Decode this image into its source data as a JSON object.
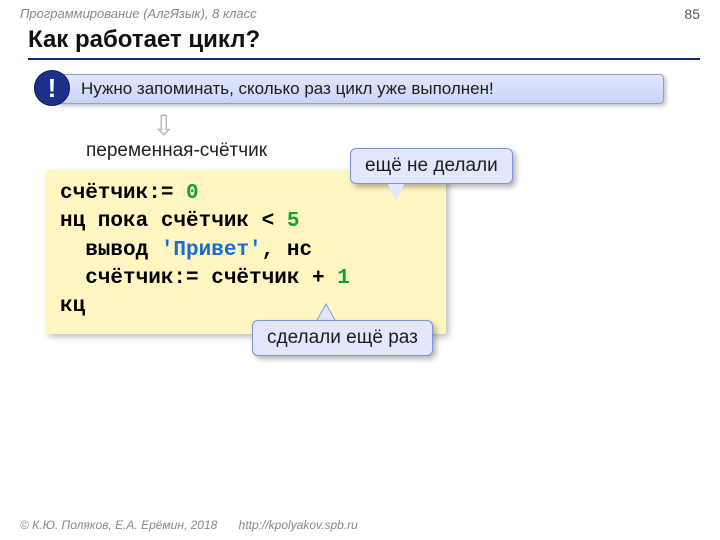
{
  "meta": {
    "course": "Программирование (АлгЯзык), 8 класс",
    "page": "85"
  },
  "title": "Как работает цикл?",
  "alert": {
    "badge": "!",
    "text": "Нужно запоминать, сколько раз цикл уже выполнен!"
  },
  "pointer": {
    "arrow": "⇩",
    "label": "переменная-счётчик"
  },
  "code": {
    "line1_a": "счётчик:= ",
    "line1_num": "0",
    "line2_a": "нц пока счётчик < ",
    "line2_num": "5",
    "line3_a": "  вывод ",
    "line3_str": "'Привет'",
    "line3_b": ", нс",
    "line4_a": "  счётчик:= счётчик + ",
    "line4_num": "1",
    "line5": "кц"
  },
  "callouts": {
    "top": "ещё не делали",
    "bottom": "сделали ещё раз"
  },
  "footer": {
    "authors": "© К.Ю. Поляков, Е.А. Ерёмин, 2018",
    "url": "http://kpolyakov.spb.ru"
  }
}
